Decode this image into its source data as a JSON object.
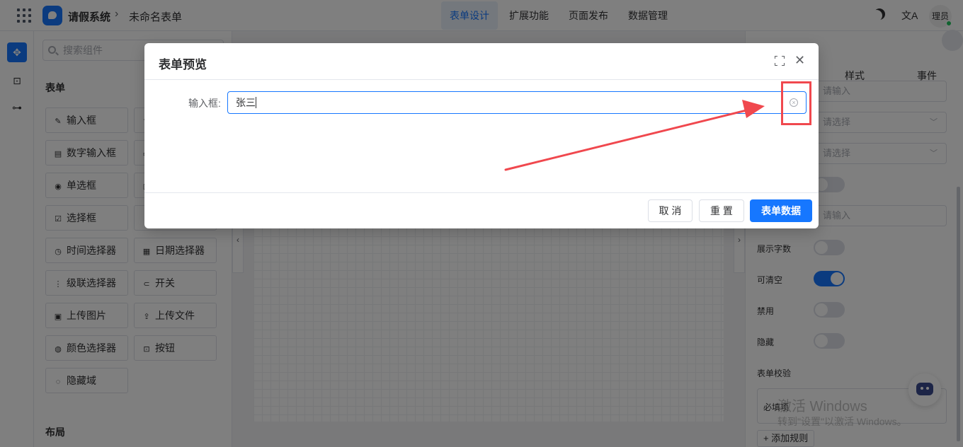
{
  "topbar": {
    "app_name": "请假系统",
    "breadcrumb_sep": "›",
    "form_name": "未命名表单",
    "tabs": [
      {
        "label": "表单设计",
        "active": true
      },
      {
        "label": "扩展功能",
        "active": false
      },
      {
        "label": "页面发布",
        "active": false
      },
      {
        "label": "数据管理",
        "active": false
      }
    ],
    "lang_icon": "文A",
    "avatar_text": "理员"
  },
  "left_panel": {
    "search_placeholder": "搜索组件",
    "section_form": "表单",
    "components": [
      {
        "icon": "✎",
        "label": "输入框"
      },
      {
        "icon": "⇅",
        "label": ""
      },
      {
        "icon": "▤",
        "label": "数字输入框"
      },
      {
        "icon": "▭",
        "label": ""
      },
      {
        "icon": "◉",
        "label": "单选框"
      },
      {
        "icon": "▢",
        "label": ""
      },
      {
        "icon": "☑",
        "label": "选择框"
      },
      {
        "icon": "●",
        "label": ""
      },
      {
        "icon": "◷",
        "label": "时间选择器"
      },
      {
        "icon": "▦",
        "label": "日期选择器"
      },
      {
        "icon": "⋮",
        "label": "级联选择器"
      },
      {
        "icon": "⊂",
        "label": "开关"
      },
      {
        "icon": "▣",
        "label": "上传图片"
      },
      {
        "icon": "⇪",
        "label": "上传文件"
      },
      {
        "icon": "◍",
        "label": "颜色选择器"
      },
      {
        "icon": "⊡",
        "label": "按钮"
      },
      {
        "icon": "◌",
        "label": "隐藏域"
      }
    ],
    "section_layout": "布局"
  },
  "right_panel": {
    "tabs": [
      "样式",
      "事件"
    ],
    "fields": [
      {
        "placeholder": "请输入",
        "type": "input"
      },
      {
        "placeholder": "请选择",
        "type": "select"
      },
      {
        "placeholder": "请选择",
        "type": "select"
      },
      {
        "placeholder": "请输入",
        "type": "input"
      }
    ],
    "switches": [
      {
        "label": "展示字数",
        "on": false
      },
      {
        "label": "可清空",
        "on": true
      },
      {
        "label": "禁用",
        "on": false
      },
      {
        "label": "隐藏",
        "on": false
      }
    ],
    "validation_title": "表单校验",
    "required_label": "必填项",
    "add_rule": "+ 添加规则",
    "watermark_line1": "激活 Windows",
    "watermark_line2": "转到\"设置\"以激活 Windows。"
  },
  "dialog": {
    "title": "表单预览",
    "field_label": "输入框:",
    "field_value": "张三",
    "cancel": "取 消",
    "reset": "重 置",
    "submit": "表单数据"
  },
  "colors": {
    "primary": "#1677ff",
    "annotation_red": "#f0484e"
  }
}
